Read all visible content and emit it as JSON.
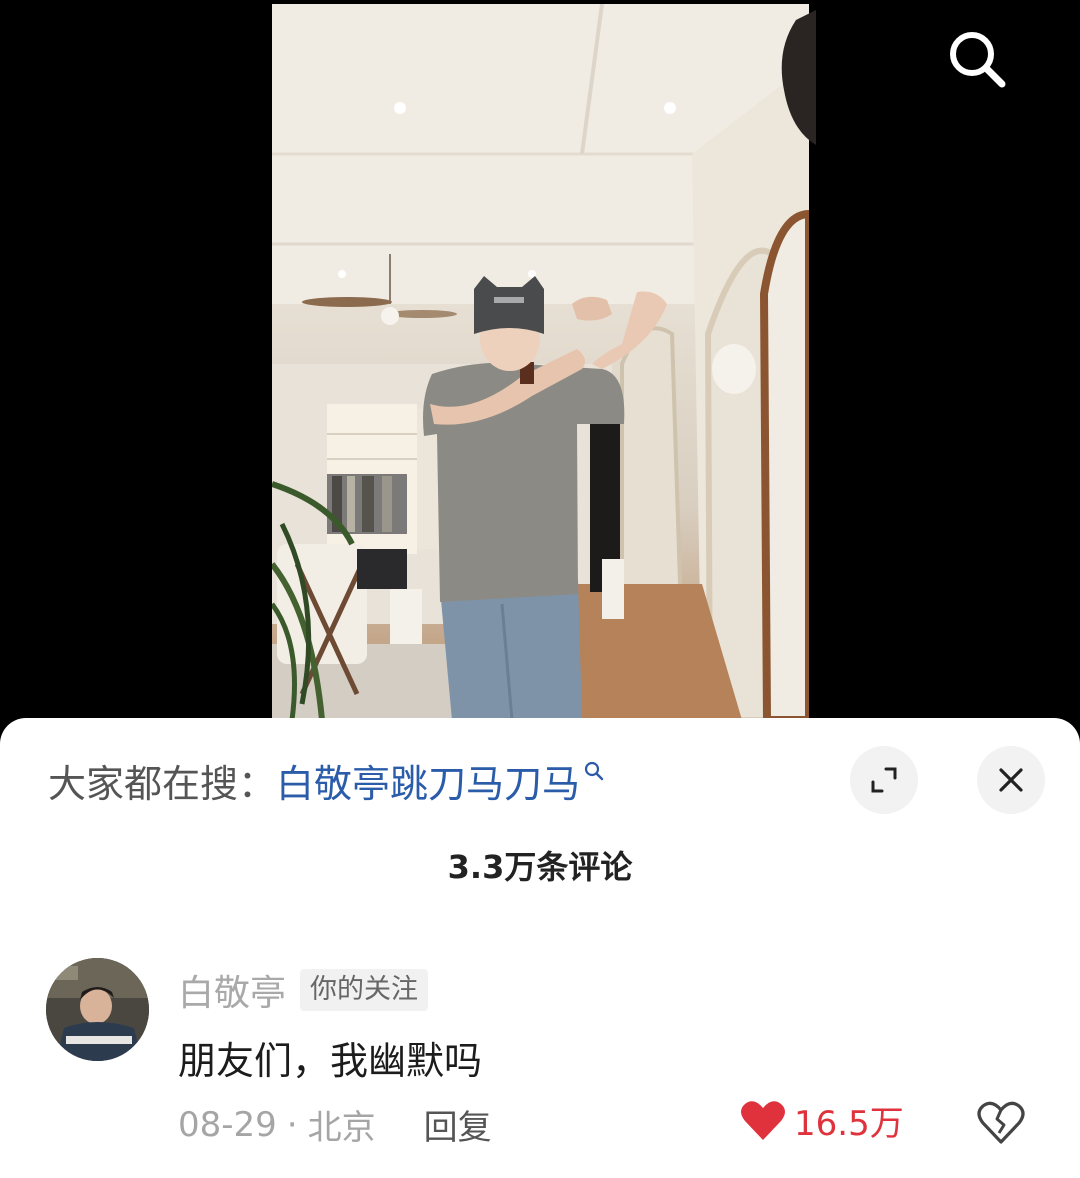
{
  "video": {
    "search_icon": "search-icon"
  },
  "sheet": {
    "hot_search": {
      "prefix": "大家都在搜：",
      "term": "白敬亭跳刀马刀马",
      "term_icon": "search-small-icon"
    },
    "expand_icon": "expand-icon",
    "close_icon": "close-icon",
    "comment_count": "3.3万条评论"
  },
  "comment": {
    "author": "白敬亭",
    "badge": "你的关注",
    "text": "朋友们，我幽默吗",
    "date": "08-29",
    "separator": "·",
    "location": "北京",
    "reply": "回复",
    "likes": "16.5万",
    "like_icon": "heart-filled-icon",
    "dislike_icon": "broken-heart-icon"
  },
  "colors": {
    "accent_blue": "#2a5caa",
    "like_red": "#e0323c",
    "background": "#000000",
    "sheet": "#ffffff"
  }
}
